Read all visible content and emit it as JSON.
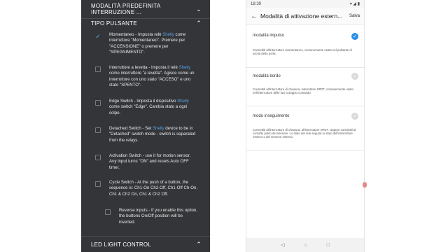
{
  "left_panel": {
    "section_mode_title": "MODALITÀ PREDEFINITA INTERRUZIONE ...",
    "section_button_type_title": "TIPO PULSANTE",
    "section_led_title": "LED LIGHT CONTROL",
    "options": [
      {
        "pre": "Momentaneo - Imposta relè ",
        "shelly": "Shelly",
        "post": " come interruttore \"Momentaneo\". Premere per \"ACCENSIONE\" o premere per \"SPEGNIMENTO\".",
        "checked": true
      },
      {
        "pre": "Interruttore a levetta - Imposta il relè ",
        "shelly": "Shelly",
        "post": " come interruttore \"a levetta\". Agisce come un interruttore con uno stato \"ACCESO\" e uno stato \"SPENTO\".",
        "checked": false
      },
      {
        "pre": "Edge Switch - Imposta il dispositivo ",
        "shelly": "Shelly",
        "post": " come switch \"Edge\". Cambia stato a ogni colpo.",
        "checked": false
      },
      {
        "pre": "Detached Switch - Set ",
        "shelly": "Shelly",
        "post": " device to be in \"Detached\" switch mode - switch is separated from the relays.",
        "checked": false
      },
      {
        "pre": "Activation Switch - use it for motion sensor. Any input turns \"ON\" and resets Auto OFF timer.",
        "shelly": "",
        "post": "",
        "checked": false
      },
      {
        "pre": "Cycle Switch - At the push of a button, the sequence is: Ch1-On Ch2-Off, Ch1-Off Ch-On, Ch1 & Ch2 On, Ch1 & Ch2 Off.",
        "shelly": "",
        "post": "",
        "checked": false
      },
      {
        "pre": "Reverse inputs - If you enable this option, the buttons On/Off position will be inverted.",
        "shelly": "",
        "post": "",
        "checked": false
      }
    ]
  },
  "phone": {
    "status_time": "18:39",
    "title": "Modalità di attivazione estern...",
    "save_label": "Salva",
    "back_glyph": "←",
    "items": [
      {
        "title": "modalità impulso",
        "desc": "Connettiti all'interruttore momentaneo, comunemente usato nel pulsante di uscita della porta.",
        "selected": true
      },
      {
        "title": "modalità bordo",
        "desc": "Connettiti all'interruttore di chiusura, interruttore SPDT, comunemente usato nell'interruttore delle luci a doppio comando",
        "selected": false
      },
      {
        "title": "modo inseguimento",
        "desc": "Connettiti all'interruttore di chiusura, all'interruttore SPDT. Oppure connettiti al contatto pulito del sensore. Lo stato del relè seguirà lo stato dell'interruttore esterno o del sensore esterno.",
        "selected": false
      }
    ],
    "nav": [
      "◁",
      "○",
      "□"
    ]
  },
  "colors": {
    "left_bg": "#333538",
    "accent": "#2b8ee8",
    "shelly_link": "#5aa0e6"
  },
  "icons": [
    "chevron-down-icon",
    "chevron-up-icon",
    "check-icon",
    "back-arrow-icon"
  ]
}
